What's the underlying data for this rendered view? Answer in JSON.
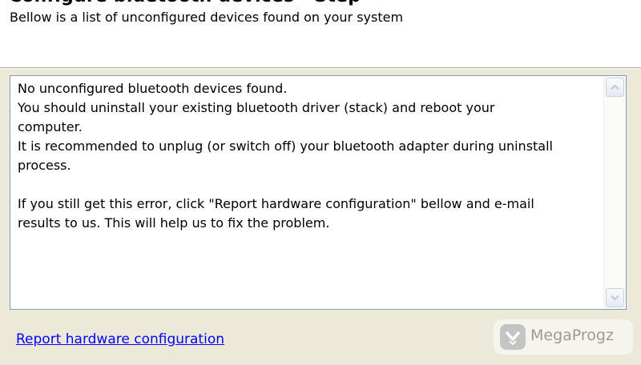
{
  "header": {
    "title": "Configure bluetooth devices - Step",
    "subtitle": "Bellow is a list of unconfigured devices found on your system"
  },
  "message": {
    "text": "No unconfigured bluetooth devices found.\nYou should uninstall your existing bluetooth driver (stack) and reboot your\ncomputer.\nIt is recommended to unplug (or switch off) your bluetooth adapter during uninstall\nprocess.\n\nIf you still get this error, click \"Report hardware configuration\" bellow and e-mail\nresults to us. This will help us to fix the problem."
  },
  "footer": {
    "report_link": "Report hardware configuration"
  },
  "watermark": {
    "text": "MegaProgz",
    "icon": "megaprogz-logo-icon"
  },
  "colors": {
    "window_bg": "#ece9d8",
    "header_bg": "#ffffff",
    "link": "#0000ff",
    "textbox_border": "#7f9db9"
  }
}
